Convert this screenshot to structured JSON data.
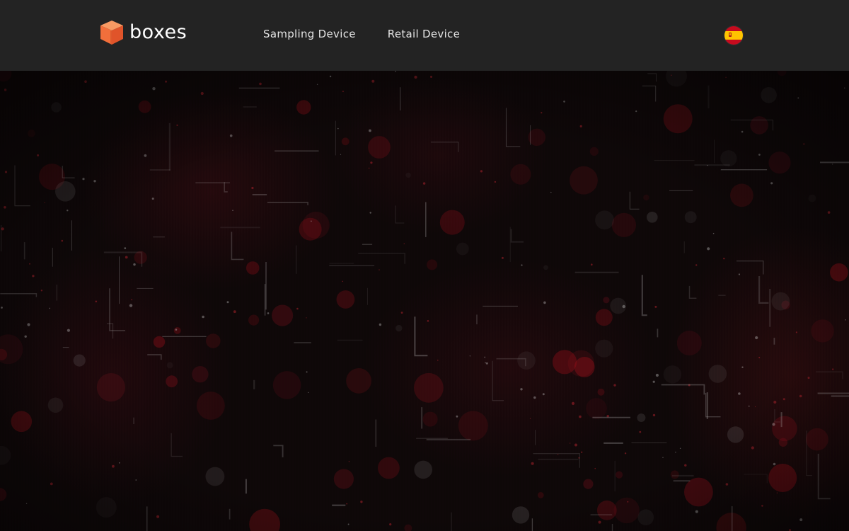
{
  "header": {
    "logo": {
      "text": "boxes",
      "icon": "orange-cube-icon",
      "brand_color": "#f2673a"
    },
    "nav": [
      {
        "label": "Sampling Device"
      },
      {
        "label": "Retail Device"
      }
    ],
    "language": {
      "icon": "spain-flag-icon"
    }
  },
  "hero": {
    "background": "dark-red-particle-video",
    "accent_color": "#7a1520"
  }
}
